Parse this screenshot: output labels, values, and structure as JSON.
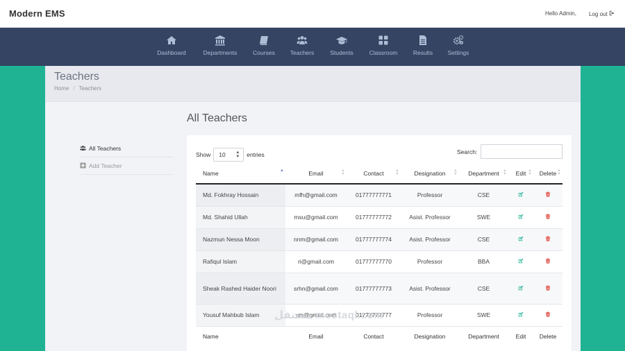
{
  "brand": "Modern EMS",
  "header": {
    "greeting": "Hello Admin,",
    "logout": "Log out"
  },
  "nav": [
    {
      "label": "Dashboard",
      "icon": "home-icon"
    },
    {
      "label": "Departments",
      "icon": "bank-icon"
    },
    {
      "label": "Courses",
      "icon": "book-icon"
    },
    {
      "label": "Teachers",
      "icon": "users-icon"
    },
    {
      "label": "Students",
      "icon": "graduation-cap-icon"
    },
    {
      "label": "Classroom",
      "icon": "grid-icon"
    },
    {
      "label": "Results",
      "icon": "document-icon"
    },
    {
      "label": "Settings",
      "icon": "gears-icon"
    }
  ],
  "page": {
    "title": "Teachers",
    "breadcrumb": [
      "Home",
      "Teachers"
    ],
    "section_title": "All Teachers"
  },
  "sidebar": {
    "items": [
      {
        "label": "All Teachers",
        "icon": "users-icon"
      },
      {
        "label": "Add Teacher",
        "icon": "plus-square-icon"
      }
    ]
  },
  "table": {
    "show_label": "Show",
    "entries_value": "10",
    "entries_label": "entries",
    "search_label": "Search:",
    "columns": [
      "Name",
      "Email",
      "Contact",
      "Designation",
      "Department",
      "Edit",
      "Delete"
    ],
    "rows": [
      {
        "name": "Md. Fokhray Hossain",
        "email": "mfh@gmail.com",
        "contact": "01777777771",
        "designation": "Professor",
        "department": "CSE"
      },
      {
        "name": "Md. Shahid Ullah",
        "email": "msu@gmail.com",
        "contact": "01777777772",
        "designation": "Asist. Professor",
        "department": "SWE"
      },
      {
        "name": "Nazmun Nessa Moon",
        "email": "nnm@gmail.com",
        "contact": "01777777774",
        "designation": "Asist. Professor",
        "department": "CSE"
      },
      {
        "name": "Rafiqul Islam",
        "email": "ri@gmail.com",
        "contact": "01777777770",
        "designation": "Professor",
        "department": "BBA"
      },
      {
        "name": "Sheak Rashed Haider Noori",
        "email": "srhn@gmail.com",
        "contact": "01777777773",
        "designation": "Asist. Professor",
        "department": "CSE"
      },
      {
        "name": "Yousuf Mahbub Islam",
        "email": "ym@gmail.com",
        "contact": "01777777777",
        "designation": "Professor",
        "department": "SWE"
      }
    ]
  },
  "watermark": "مستقل mostaql.com",
  "colors": {
    "accent": "#1fb394",
    "navbar": "#344462",
    "edit": "#1fb394",
    "delete": "#e0443b"
  }
}
